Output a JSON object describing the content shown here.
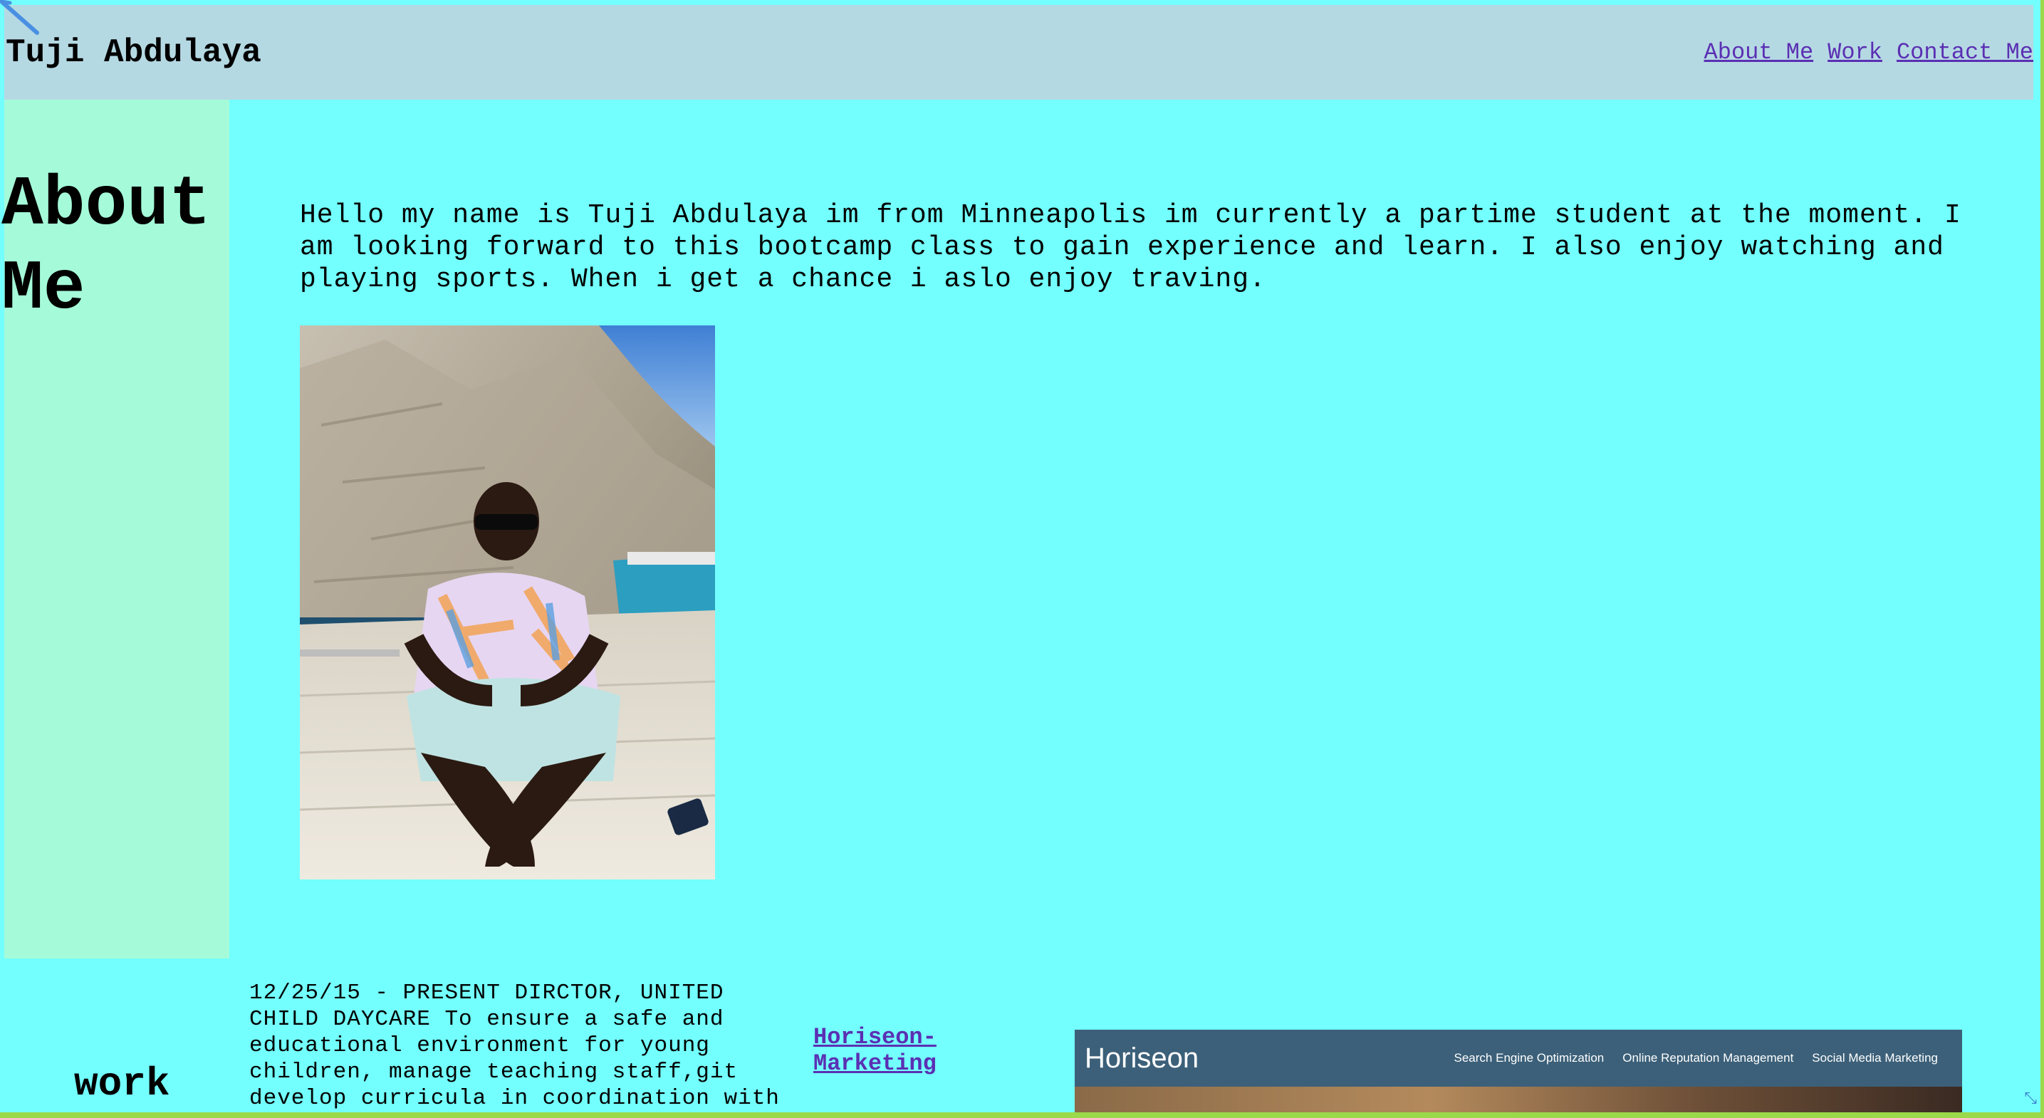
{
  "header": {
    "title": "Tuji Abdulaya",
    "nav": [
      {
        "label": "About Me"
      },
      {
        "label": "Work"
      },
      {
        "label": "Contact Me"
      }
    ]
  },
  "about": {
    "heading": "About Me",
    "body": "Hello my name is Tuji Abdulaya im from Minneapolis im currently a partime student at the moment. I am looking forward to this bootcamp class to gain experience and learn. I also enjoy watching and playing sports. When i get a chance i aslo enjoy traving.",
    "photo_icon": "profile-photo"
  },
  "work": {
    "heading": "work",
    "description": "12/25/15 - PRESENT DIRCTOR, UNITED CHILD DAYCARE To ensure a safe and educational environment for young children, manage teaching staff,git develop curricula in coordination with",
    "project": {
      "link_label": "Horiseon-Marketing",
      "screenshot": {
        "logo": "Horiseon",
        "nav": [
          "Search Engine Optimization",
          "Online Reputation Management",
          "Social Media Marketing"
        ]
      }
    }
  },
  "colors": {
    "page_bg": "#73fffd",
    "header_bg": "#b5d9e3",
    "sidebar_bg": "#a5fbd9",
    "link": "#5b2fb3",
    "frame": "#9ad94a"
  }
}
